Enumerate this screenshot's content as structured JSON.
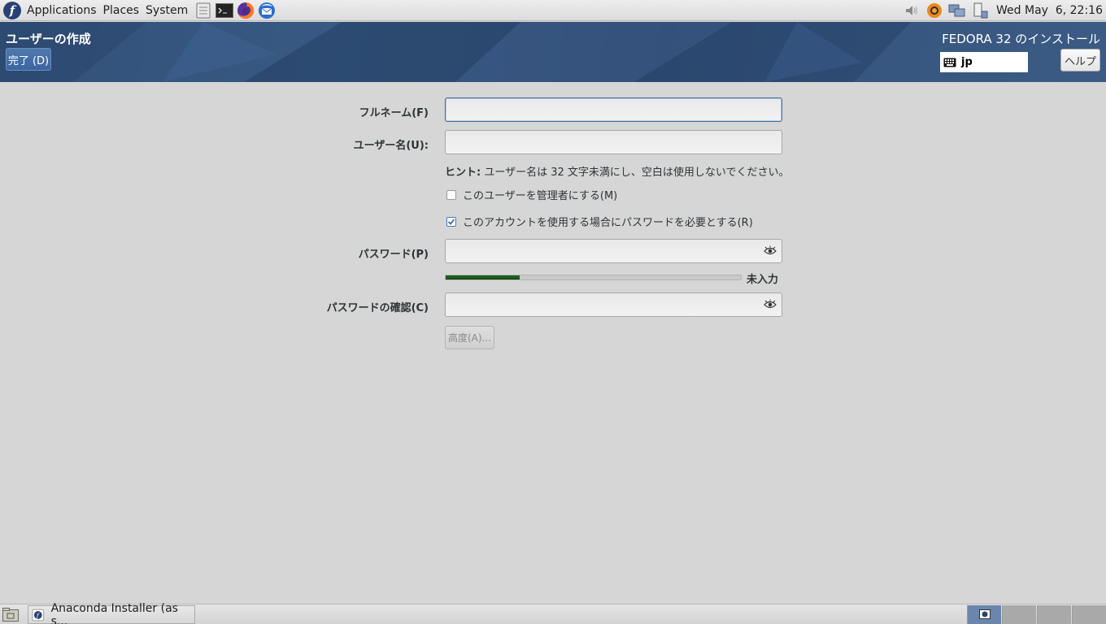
{
  "top_panel": {
    "menus": [
      "Applications",
      "Places",
      "System"
    ],
    "launchers": [
      "file-manager-icon",
      "terminal-icon",
      "firefox-icon",
      "thunderbird-icon"
    ],
    "tray_icons": [
      "volume-icon",
      "update-notifier-icon",
      "network-icon",
      "power-icon"
    ],
    "clock": "Wed May  6, 22:16"
  },
  "header": {
    "spoke_title": "ユーザーの作成",
    "done_label": "完了 (D)",
    "product_title": "FEDORA 32 のインストール",
    "keyboard_layout": "jp",
    "help_label": "ヘルプ"
  },
  "form": {
    "fullname_label": "フルネーム(F)",
    "fullname_value": "",
    "username_label": "ユーザー名(U):",
    "username_value": "",
    "hint_prefix": "ヒント:",
    "hint_text": " ユーザー名は 32 文字未満にし、空白は使用しないでください。",
    "admin_checkbox_label": "このユーザーを管理者にする(M)",
    "admin_checked": false,
    "require_password_label": "このアカウントを使用する場合にパスワードを必要とする(R)",
    "require_password_checked": true,
    "password_label": "パスワード(P)",
    "password_value": "",
    "strength_text": "未入力",
    "strength_fraction": 0.25,
    "confirm_label": "パスワードの確認(C)",
    "confirm_value": "",
    "advanced_label": "高度(A)..."
  },
  "bottom_panel": {
    "task_label": "Anaconda Installer (as s...",
    "workspaces": 4,
    "active_workspace": 1
  }
}
